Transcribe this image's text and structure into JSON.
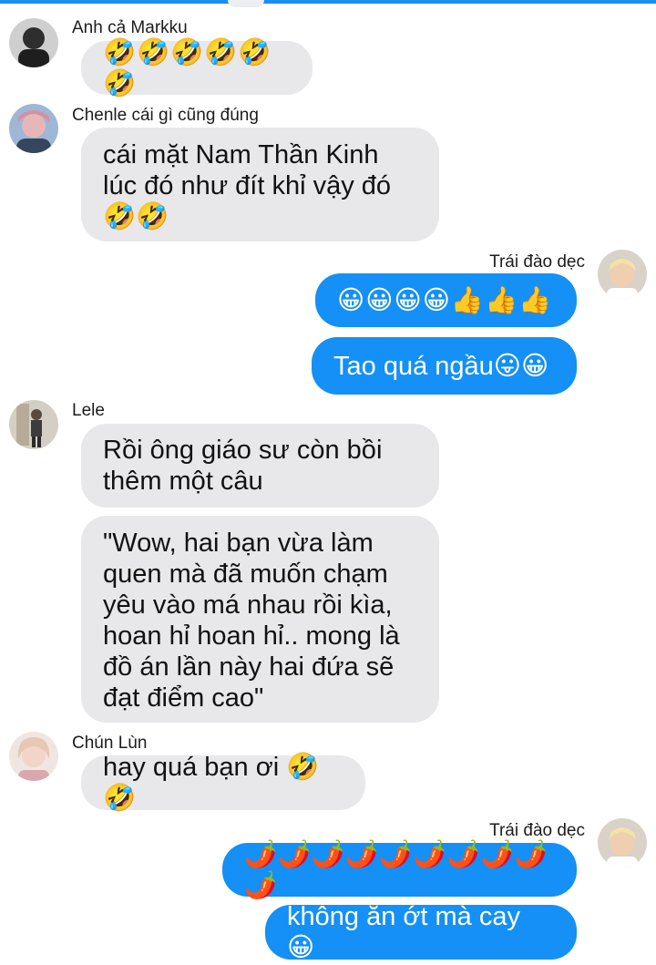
{
  "messages": [
    {
      "sender": "Anh cả Markku",
      "text": "🤣🤣🤣🤣🤣🤣"
    },
    {
      "sender": "Chenle cái gì cũng đúng",
      "text": "cái mặt Nam Thần Kinh\nlúc đó như đít khỉ vậy đó\n🤣🤣"
    },
    {
      "sender": "Trái đào dẹc",
      "text": "😀😀😀😀👍👍👍"
    },
    {
      "text": "Tao quá ngầu😛😀"
    },
    {
      "sender": "Lele",
      "text": "Rồi ông giáo sư còn bồi\nthêm một câu"
    },
    {
      "text": "\"Wow, hai bạn vừa làm\nquen mà đã muốn chạm\nyêu vào má nhau rồi kìa,\nhoan hỉ hoan hỉ.. mong là\nđồ án lần này hai đứa sẽ\nđạt điểm cao\""
    },
    {
      "sender": "Chún Lùn",
      "text": "hay quá bạn ơi 🤣🤣"
    },
    {
      "sender": "Trái đào dẹc",
      "text": "🌶️🌶️🌶️🌶️🌶️🌶️🌶️🌶️🌶️🌶️"
    },
    {
      "text": "không ăn ớt mà cay 😀"
    }
  ],
  "colors": {
    "outgoing": "#1490f6",
    "incoming": "#e8e8ea",
    "accent": "#1b8ff0"
  }
}
